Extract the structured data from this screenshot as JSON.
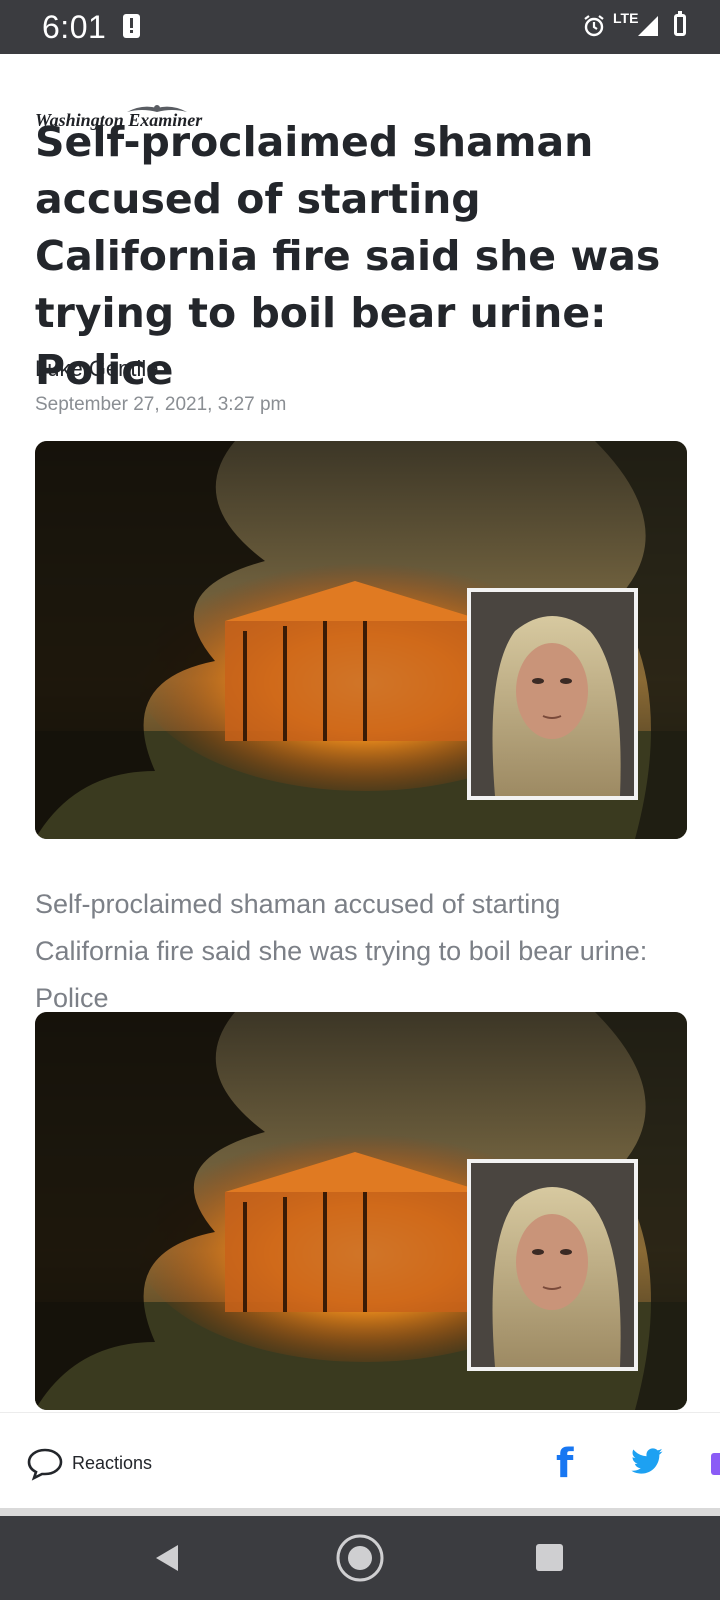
{
  "status_bar": {
    "time": "6:01",
    "network": "LTE",
    "icons": [
      "alert-icon",
      "alarm-icon",
      "signal-icon",
      "battery-icon"
    ]
  },
  "article": {
    "publication_logo": "Washington Examiner",
    "headline": "Self-proclaimed shaman accused of starting California fire said she was trying to boil bear urine: Police",
    "author": "Luke Gentile",
    "date": "September 27, 2021, 3:27 pm",
    "image_caption": "Self-proclaimed shaman accused of starting California fire said she was trying to boil bear urine: Police"
  },
  "action_bar": {
    "reactions_label": "Reactions",
    "icons": [
      "comment-icon",
      "facebook-icon",
      "twitter-icon",
      "share-more-icon"
    ],
    "colors": {
      "facebook": "#1877f2",
      "twitter": "#1da1f2"
    }
  },
  "nav_bar": {
    "icons": [
      "back-icon",
      "home-icon",
      "recents-icon"
    ]
  },
  "colors": {
    "status_bar_bg": "#3b3c40",
    "headline_text": "#23262b",
    "meta_text": "#8a8e93"
  }
}
